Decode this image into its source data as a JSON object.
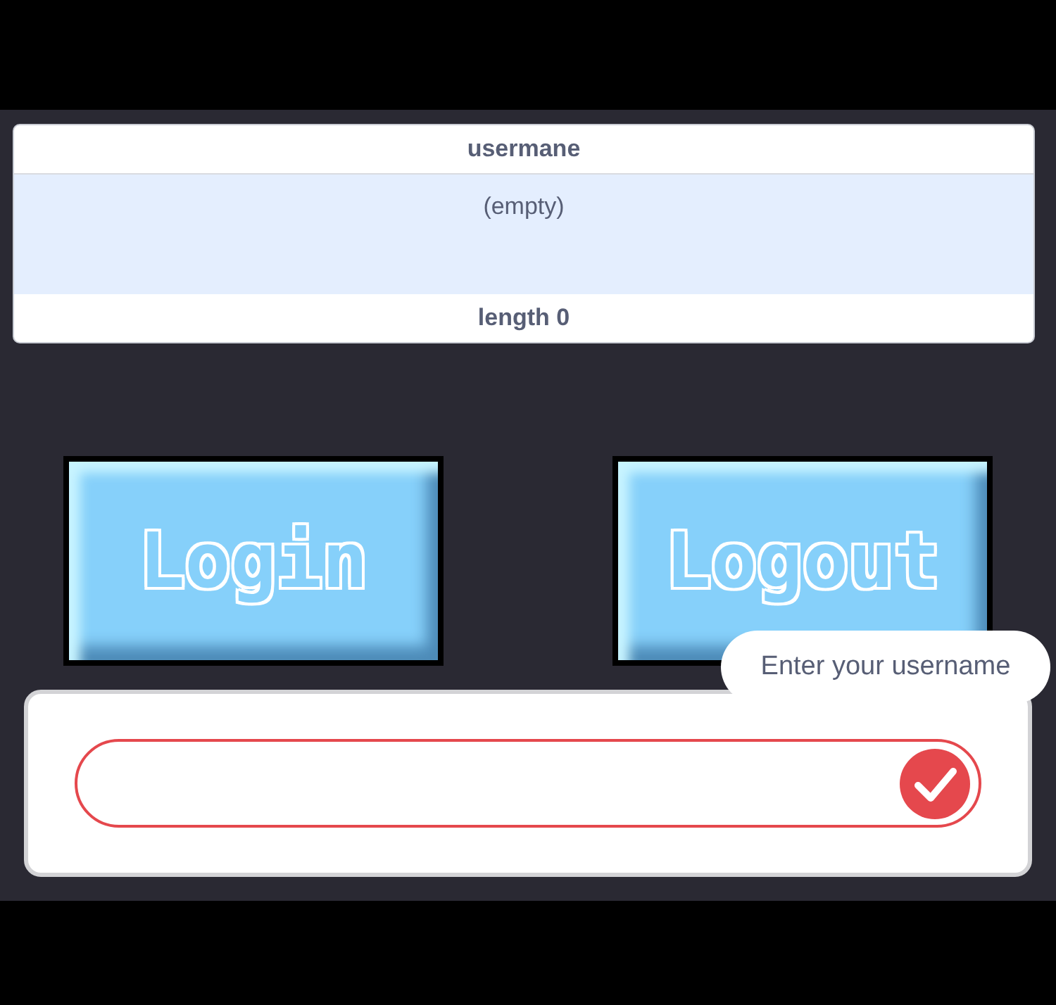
{
  "variable_monitor": {
    "title": "usermane",
    "value": "(empty)",
    "footer": "length 0"
  },
  "buttons": [
    {
      "label": "Login"
    },
    {
      "label": "Logout"
    }
  ],
  "ask_prompt": {
    "bubble": "Enter your username"
  }
}
